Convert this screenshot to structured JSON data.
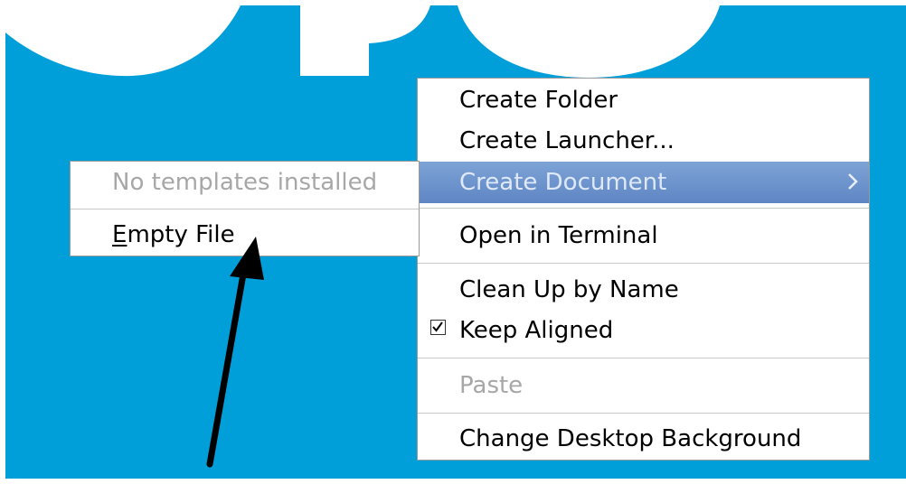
{
  "main_menu": {
    "items": [
      {
        "label": "Create Folder"
      },
      {
        "label": "Create Launcher..."
      },
      {
        "label": "Create Document",
        "has_submenu": true,
        "highlighted": true
      },
      {
        "label": "Open in Terminal"
      },
      {
        "label": "Clean Up by Name"
      },
      {
        "label": "Keep Aligned",
        "checked": true
      },
      {
        "label": "Paste",
        "disabled": true
      },
      {
        "label": "Change Desktop Background"
      }
    ]
  },
  "sub_menu": {
    "header": "No templates installed",
    "empty_file_mnemonic": "E",
    "empty_file_rest": "mpty File"
  },
  "colors": {
    "desktop": "#009fd9",
    "highlight": "#6b90ca",
    "disabled_text": "#a7a7a7"
  }
}
